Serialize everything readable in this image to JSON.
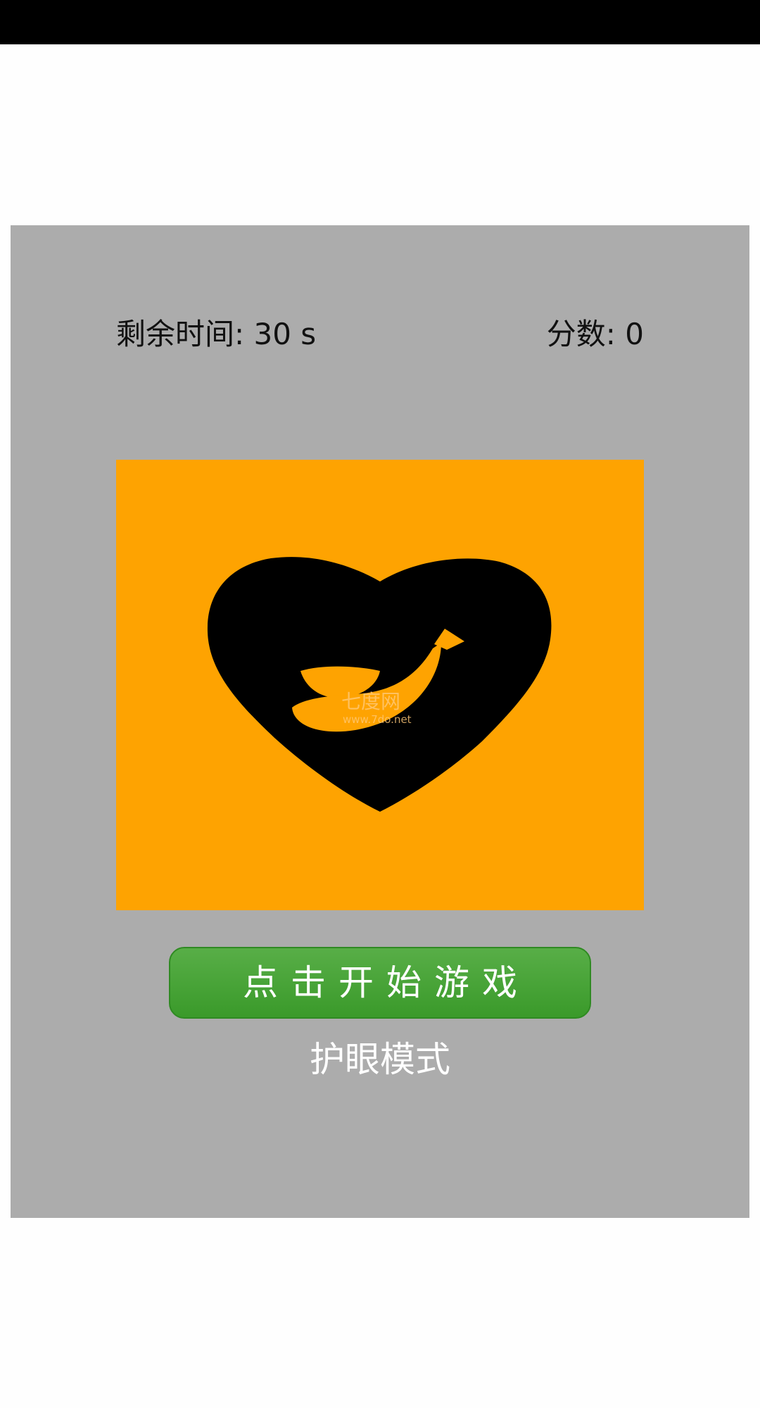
{
  "hud": {
    "time_label": "剩余时间: 30 s",
    "score_label": "分数: 0"
  },
  "target": {
    "icon": "heart-banana-icon",
    "background_color": "#fea301",
    "watermark_title": "七度网",
    "watermark_url": "www.7do.net"
  },
  "controls": {
    "start_label": "点击开始游戏",
    "eye_mode_label": "护眼模式"
  },
  "colors": {
    "panel": "#acacac",
    "button": "#45a234"
  }
}
